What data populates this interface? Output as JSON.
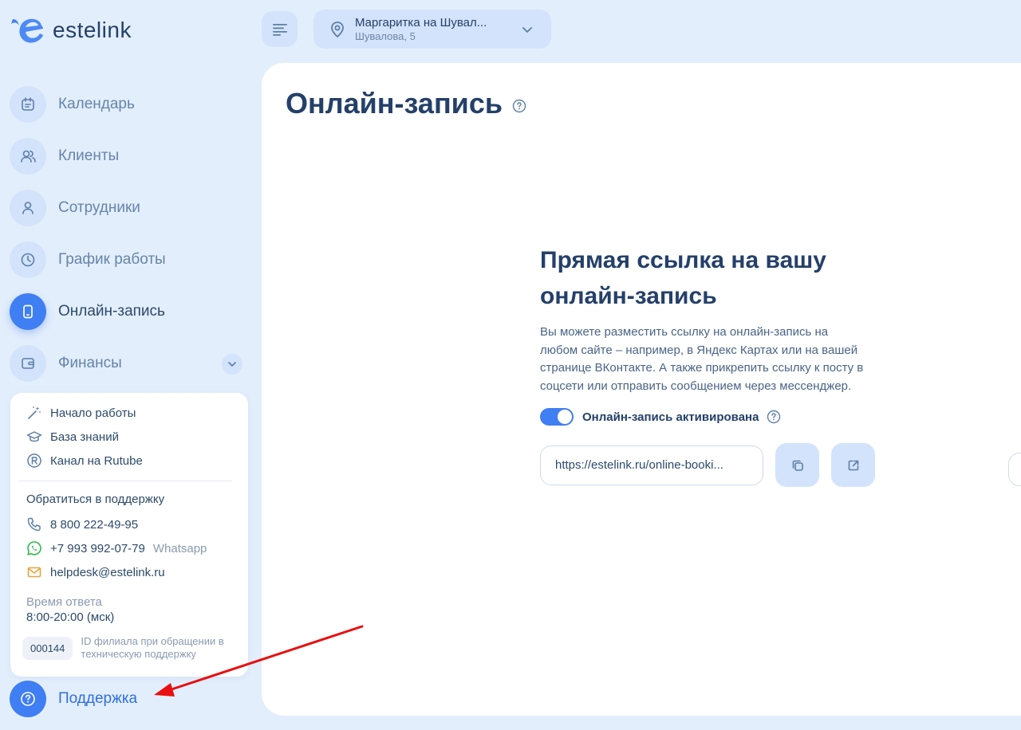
{
  "app": {
    "logo_text": "estelink"
  },
  "header": {
    "branch_name": "Маргаритка на Шувал...",
    "branch_address": "Шувалова, 5"
  },
  "sidebar": {
    "items": [
      {
        "label": "Календарь",
        "icon": "calendar-icon"
      },
      {
        "label": "Клиенты",
        "icon": "users-icon"
      },
      {
        "label": "Сотрудники",
        "icon": "user-icon"
      },
      {
        "label": "График работы",
        "icon": "clock-icon"
      },
      {
        "label": "Онлайн-запись",
        "icon": "phone-icon",
        "active": true
      },
      {
        "label": "Финансы",
        "icon": "wallet-icon"
      }
    ],
    "support_label": "Поддержка"
  },
  "help_card": {
    "links": [
      {
        "label": "Начало работы",
        "icon": "magic-wand-icon"
      },
      {
        "label": "База знаний",
        "icon": "graduation-cap-icon"
      },
      {
        "label": "Канал на Rutube",
        "icon": "rutube-icon"
      }
    ],
    "support_title": "Обратиться в поддержку",
    "phone": "8 800 222-49-95",
    "whatsapp": "+7 993 992-07-79",
    "whatsapp_label": "Whatsapp",
    "email": "helpdesk@estelink.ru",
    "response_label": "Время ответа",
    "response_time": "8:00-20:00 (мск)",
    "branch_id": "000144",
    "branch_id_note": "ID филиала при обращении в техническую поддержку"
  },
  "main": {
    "page_title": "Онлайн-запись",
    "section_title": "Прямая ссылка на вашу онлайн-запись",
    "section_desc": "Вы можете разместить ссылку на онлайн-запись на любом сайте – например, в Яндекс Картах или на вашей странице ВКонтакте. А также прикрепить ссылку к посту в соцсети или отправить сообщением через мессенджер.",
    "toggle_label": "Онлайн-запись активирована",
    "toggle_on": true,
    "link_value": "https://estelink.ru/online-booki..."
  },
  "colors": {
    "accent": "#3f7ef3",
    "background": "#e3eefc",
    "annotation_arrow": "#e81010"
  }
}
